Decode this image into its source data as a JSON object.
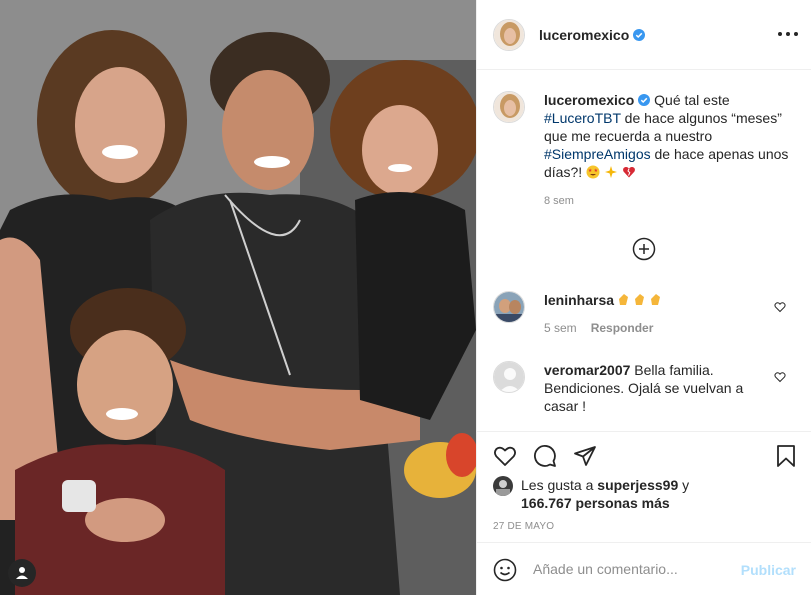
{
  "post": {
    "username": "luceromexico",
    "verified": true,
    "caption": {
      "username": "luceromexico",
      "text_1": " Qué tal este ",
      "hashtag_1": "#LuceroTBT",
      "text_2": " de hace algunos “meses” que me recuerda a nuestro ",
      "hashtag_2": "#SiempreAmigos",
      "text_3": " de hace apenas unos días?! ",
      "emojis": [
        "star-struck",
        "sparkles",
        "broken-heart"
      ],
      "time": "8 sem"
    },
    "comments": [
      {
        "username": "leninharsa",
        "text": "",
        "emojis": [
          "clapping-hands",
          "clapping-hands",
          "clapping-hands"
        ],
        "time": "5 sem",
        "reply_label": "Responder"
      },
      {
        "username": "veromar2007",
        "text": " Bella familia. Bendiciones. Ojalá se vuelvan a casar !"
      }
    ],
    "likes": {
      "prefix": "Les gusta a ",
      "user": "superjess99",
      "middle": " y",
      "count": "166.767 personas más"
    },
    "date": "27 DE MAYO",
    "add_comment": {
      "placeholder": "Añade un comentario...",
      "publish_label": "Publicar"
    }
  },
  "colors": {
    "text": "#262626",
    "secondary": "#8e8e8e",
    "hashtag": "#00376b",
    "verified": "#3897f0",
    "publish_disabled": "#b2dffc",
    "border": "#efefef"
  },
  "icons": [
    "user-tag-icon",
    "more-options-icon",
    "load-more-comments-icon",
    "heart-icon",
    "comment-icon",
    "share-icon",
    "bookmark-icon",
    "emoji-icon",
    "verified-badge-icon"
  ]
}
